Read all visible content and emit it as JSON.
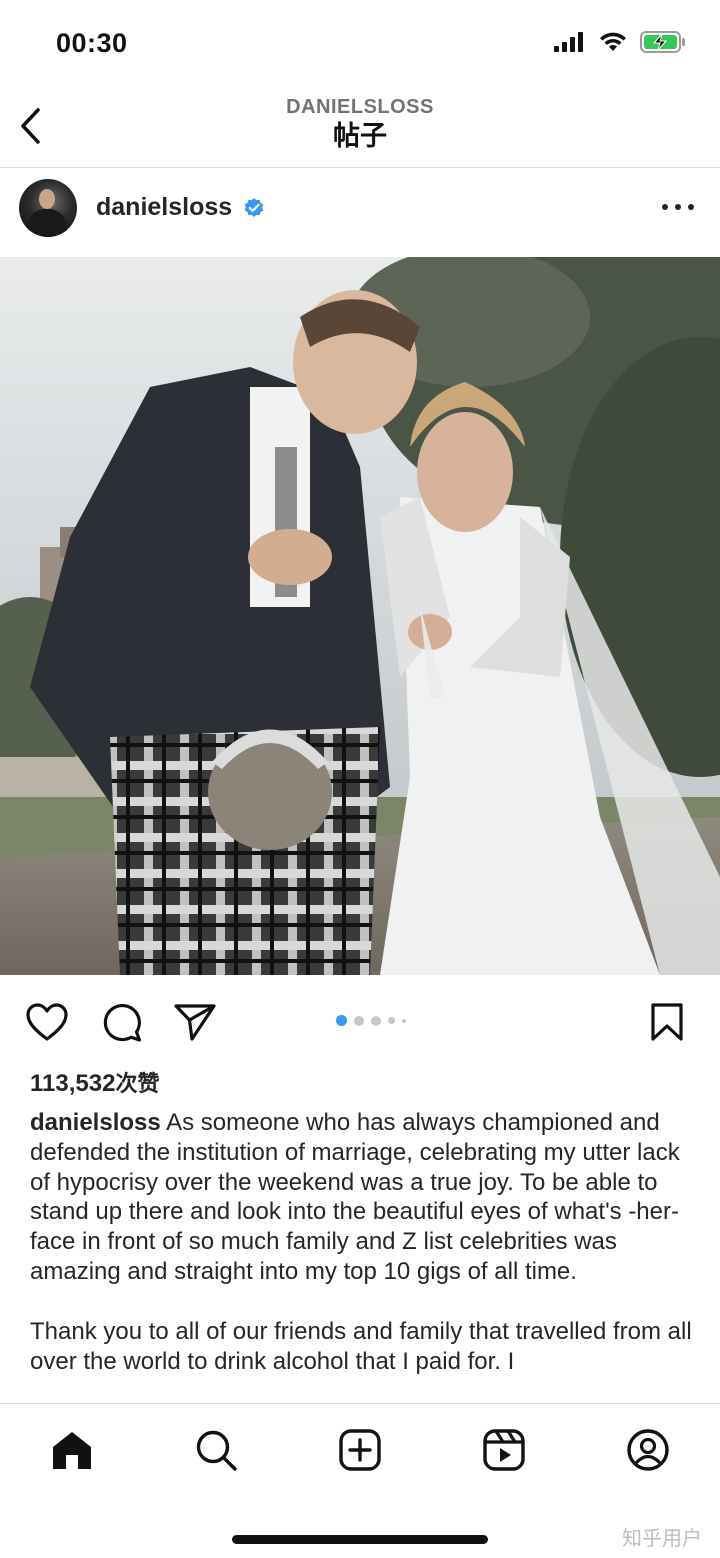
{
  "status_bar": {
    "time": "00:30"
  },
  "header": {
    "subtitle": "DANIELSLOSS",
    "title": "帖子"
  },
  "post": {
    "username": "danielsloss",
    "verified": true,
    "image_alt": "Photo of a groom in a kilt and a bride in a white lace gown posing outdoors",
    "carousel": {
      "total": 5,
      "active_index": 0
    },
    "likes_count": "113,532",
    "likes_unit": "次赞",
    "caption_username": "danielsloss",
    "caption_paragraphs": [
      "As someone who has always championed and defended the institution of marriage, celebrating my utter lack of hypocrisy over the weekend was a true joy. To be able to stand up there and look into the beautiful eyes of what's -her-face in front of so much family and Z list celebrities was amazing and straight into my top 10 gigs of all time.",
      "Thank you to all of our friends and family that travelled from all over the world to drink alcohol that I paid for. I"
    ]
  },
  "watermark": "知乎用户",
  "colors": {
    "verified_blue": "#3897f0",
    "carousel_active": "#3897f0",
    "carousel_inactive": "#c7c7c7",
    "text_primary": "#262626",
    "text_secondary": "#737373"
  }
}
